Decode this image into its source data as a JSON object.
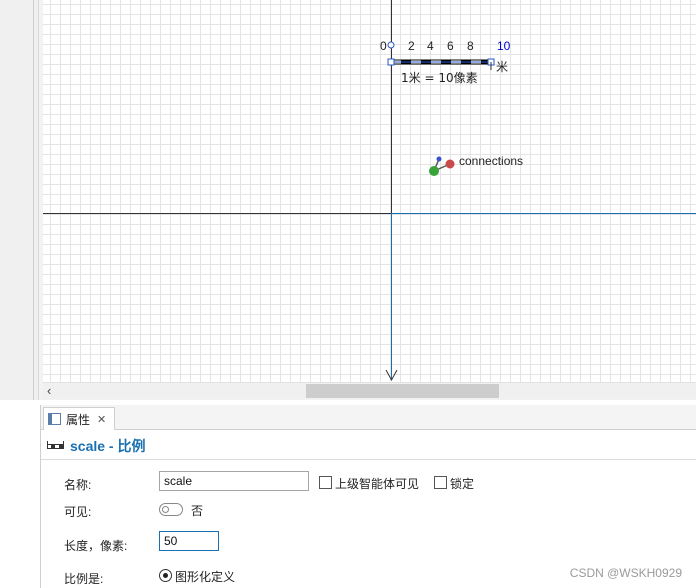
{
  "canvas": {
    "scale_ruler": {
      "ticks": [
        "0",
        "2",
        "4",
        "6",
        "8",
        "10"
      ],
      "unit": "米",
      "caption": "1米 = 10像素"
    },
    "connections_label": "connections"
  },
  "properties_panel": {
    "tab_label": "属性",
    "heading": "scale - 比例",
    "fields": {
      "name_label": "名称:",
      "name_value": "scale",
      "visible_to_upper_agent": "上级智能体可见",
      "lock": "锁定",
      "visible_label": "可见:",
      "visible_value": "否",
      "length_label": "长度，像素:",
      "length_value": "50",
      "scale_is_label": "比例是:",
      "scale_is_option": "图形化定义"
    }
  },
  "watermark": "CSDN @WSKH0929",
  "colors": {
    "accent": "#1a6fb0",
    "ruler_blue": "#0000cc",
    "axis_blue": "#1a6fb0"
  }
}
